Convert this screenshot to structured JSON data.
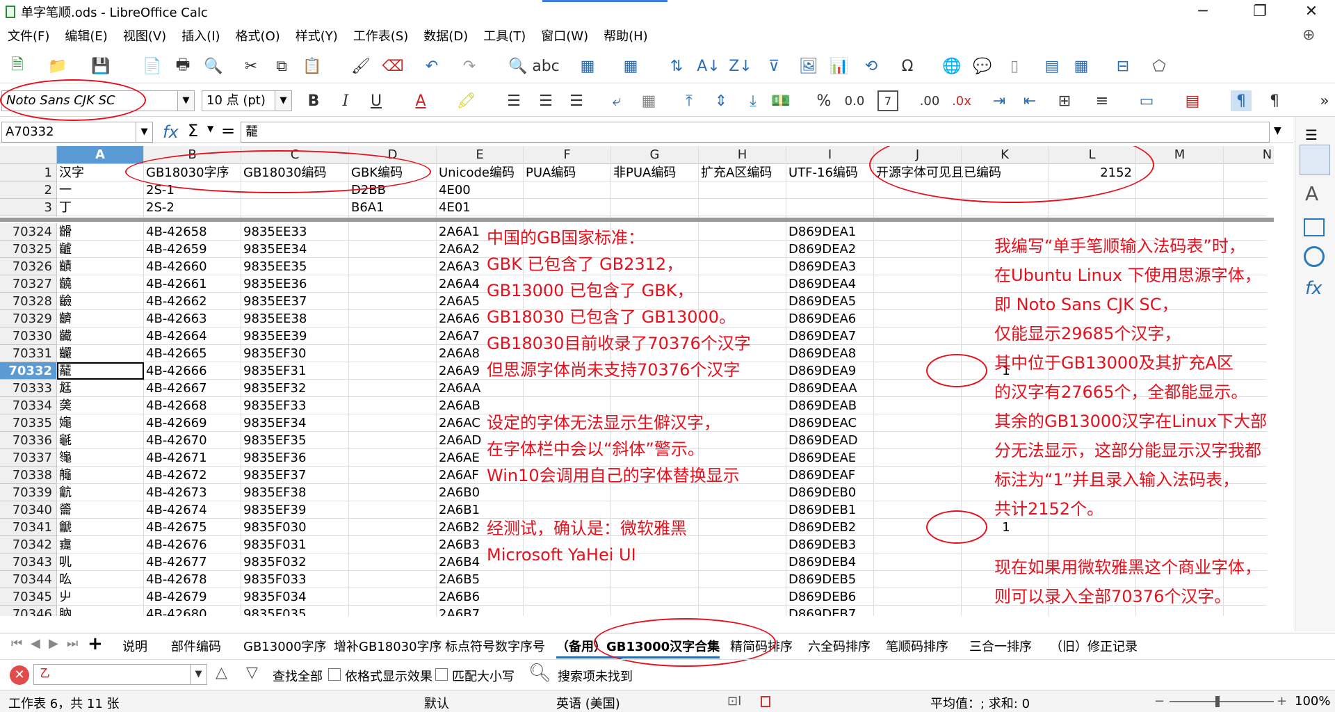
{
  "window": {
    "title": "单字笔顺.ods - LibreOffice Calc"
  },
  "menu": [
    "文件(F)",
    "编辑(E)",
    "视图(V)",
    "插入(I)",
    "格式(O)",
    "样式(Y)",
    "工作表(S)",
    "数据(D)",
    "工具(T)",
    "窗口(W)",
    "帮助(H)"
  ],
  "toolbar": {
    "font_name": "Noto Sans CJK SC",
    "font_size": "10 点 (pt)"
  },
  "formula": {
    "name_box": "A70332",
    "content": "䶬"
  },
  "columns": [
    "A",
    "B",
    "C",
    "D",
    "E",
    "F",
    "G",
    "H",
    "I",
    "J",
    "K",
    "L",
    "M",
    "N"
  ],
  "header_rows": [
    {
      "n": "1",
      "A": "汉字",
      "B": "GB18030字序",
      "C": "GB18030编码",
      "D": "GBK编码",
      "E": "Unicode编码",
      "F": "PUA编码",
      "G": "非PUA编码",
      "H": "扩充A区编码",
      "I": "UTF-16编码",
      "J": "开源字体可见且已编码",
      "L": "2152"
    },
    {
      "n": "2",
      "A": "一",
      "B": "2S-1",
      "C": "",
      "D": "D2BB",
      "E": "4E00",
      "I": ""
    },
    {
      "n": "3",
      "A": "丁",
      "B": "2S-2",
      "C": "",
      "D": "B6A1",
      "E": "4E01",
      "I": ""
    }
  ],
  "rows": [
    {
      "n": "70324",
      "A": "䶤",
      "B": "4B-42658",
      "C": "9835EE33",
      "E": "2A6A1",
      "I": "D869DEA1"
    },
    {
      "n": "70325",
      "A": "䶥",
      "B": "4B-42659",
      "C": "9835EE34",
      "E": "2A6A2",
      "I": "D869DEA2"
    },
    {
      "n": "70326",
      "A": "䶦",
      "B": "4B-42660",
      "C": "9835EE35",
      "E": "2A6A3",
      "I": "D869DEA3"
    },
    {
      "n": "70327",
      "A": "䶧",
      "B": "4B-42661",
      "C": "9835EE36",
      "E": "2A6A4",
      "I": "D869DEA4"
    },
    {
      "n": "70328",
      "A": "䶨",
      "B": "4B-42662",
      "C": "9835EE37",
      "E": "2A6A5",
      "I": "D869DEA5"
    },
    {
      "n": "70329",
      "A": "䶩",
      "B": "4B-42663",
      "C": "9835EE38",
      "E": "2A6A6",
      "I": "D869DEA6"
    },
    {
      "n": "70330",
      "A": "䶪",
      "B": "4B-42664",
      "C": "9835EE39",
      "E": "2A6A7",
      "I": "D869DEA7"
    },
    {
      "n": "70331",
      "A": "䶫",
      "B": "4B-42665",
      "C": "9835EF30",
      "E": "2A6A8",
      "I": "D869DEA8"
    },
    {
      "n": "70332",
      "A": "䶬",
      "B": "4B-42666",
      "C": "9835EF31",
      "E": "2A6A9",
      "I": "D869DEA9",
      "K": "1"
    },
    {
      "n": "70333",
      "A": "䶭",
      "B": "4B-42667",
      "C": "9835EF32",
      "E": "2A6AA",
      "I": "D869DEAA"
    },
    {
      "n": "70334",
      "A": "䶮",
      "B": "4B-42668",
      "C": "9835EF33",
      "E": "2A6AB",
      "I": "D869DEAB"
    },
    {
      "n": "70335",
      "A": "䶯",
      "B": "4B-42669",
      "C": "9835EF34",
      "E": "2A6AC",
      "I": "D869DEAC"
    },
    {
      "n": "70336",
      "A": "䶰",
      "B": "4B-42670",
      "C": "9835EF35",
      "E": "2A6AD",
      "I": "D869DEAD"
    },
    {
      "n": "70337",
      "A": "䶱",
      "B": "4B-42671",
      "C": "9835EF36",
      "E": "2A6AE",
      "I": "D869DEAE"
    },
    {
      "n": "70338",
      "A": "䶲",
      "B": "4B-42672",
      "C": "9835EF37",
      "E": "2A6AF",
      "I": "D869DEAF"
    },
    {
      "n": "70339",
      "A": "䶳",
      "B": "4B-42673",
      "C": "9835EF38",
      "E": "2A6B0",
      "I": "D869DEB0"
    },
    {
      "n": "70340",
      "A": "䶴",
      "B": "4B-42674",
      "C": "9835EF39",
      "E": "2A6B1",
      "I": "D869DEB1"
    },
    {
      "n": "70341",
      "A": "䶵",
      "B": "4B-42675",
      "C": "9835F030",
      "E": "2A6B2",
      "I": "D869DEB2",
      "K": "1"
    },
    {
      "n": "70342",
      "A": "䶶",
      "B": "4B-42676",
      "C": "9835F031",
      "E": "2A6B3",
      "I": "D869DEB3"
    },
    {
      "n": "70343",
      "A": "䶷",
      "B": "4B-42677",
      "C": "9835F032",
      "E": "2A6B4",
      "I": "D869DEB4"
    },
    {
      "n": "70344",
      "A": "䶸",
      "B": "4B-42678",
      "C": "9835F033",
      "E": "2A6B5",
      "I": "D869DEB5"
    },
    {
      "n": "70345",
      "A": "䶹",
      "B": "4B-42679",
      "C": "9835F034",
      "E": "2A6B6",
      "I": "D869DEB6"
    },
    {
      "n": "70346",
      "A": "䶺",
      "B": "4B-42680",
      "C": "9835F035",
      "E": "2A6B7",
      "I": "D869DEB7"
    }
  ],
  "active_row": "70332",
  "annotation_left": [
    "中国的GB国家标准：",
    "GBK 已包含了 GB2312，",
    "GB13000 已包含了 GBK，",
    "GB18030 已包含了 GB13000。",
    "GB18030目前收录了70376个汉字",
    "但思源字体尚未支持70376个汉字",
    "",
    "设定的字体无法显示生僻汉字，",
    "在字体栏中会以“斜体”警示。",
    "Win10会调用自己的字体替换显示",
    "",
    "经测试，确认是：微软雅黑",
    "Microsoft YaHei UI"
  ],
  "annotation_right": [
    "我编写“单手笔顺输入法码表”时，",
    "在Ubuntu Linux 下使用思源字体，",
    "即 Noto Sans CJK SC，",
    "仅能显示29685个汉字，",
    "其中位于GB13000及其扩充A区",
    "的汉字有27665个，全都能显示。",
    "其余的GB13000汉字在Linux下大部",
    "分无法显示，这部分能显示汉字我都",
    "标注为“1”并且录入输入法码表，",
    "共计2152个。",
    "",
    "现在如果用微软雅黑这个商业字体，",
    "则可以录入全部70376个汉字。"
  ],
  "sheet_tabs": [
    "说明",
    "部件编码",
    "GB13000字序",
    "增补GB18030字序",
    "标点符号数字序号",
    "（备用）GB13000汉字合集",
    "精简码排序",
    "六全码排序",
    "笔顺码排序",
    "三合一排序",
    "（旧）修正记录"
  ],
  "active_tab": "（备用）GB13000汉字合集",
  "findbar": {
    "search_value": "㇠",
    "find_all": "查找全部",
    "format_display": "依格式显示效果",
    "match_case": "匹配大小写",
    "status": "搜索项未找到"
  },
  "status": {
    "sheet": "工作表 6，共 11 张",
    "style": "默认",
    "language": "英语 (美国)",
    "sum": "平均值：; 求和: 0",
    "zoom": "100%"
  },
  "colors": {
    "annotation": "#e8101c",
    "active_header": "#5b9bd5"
  }
}
